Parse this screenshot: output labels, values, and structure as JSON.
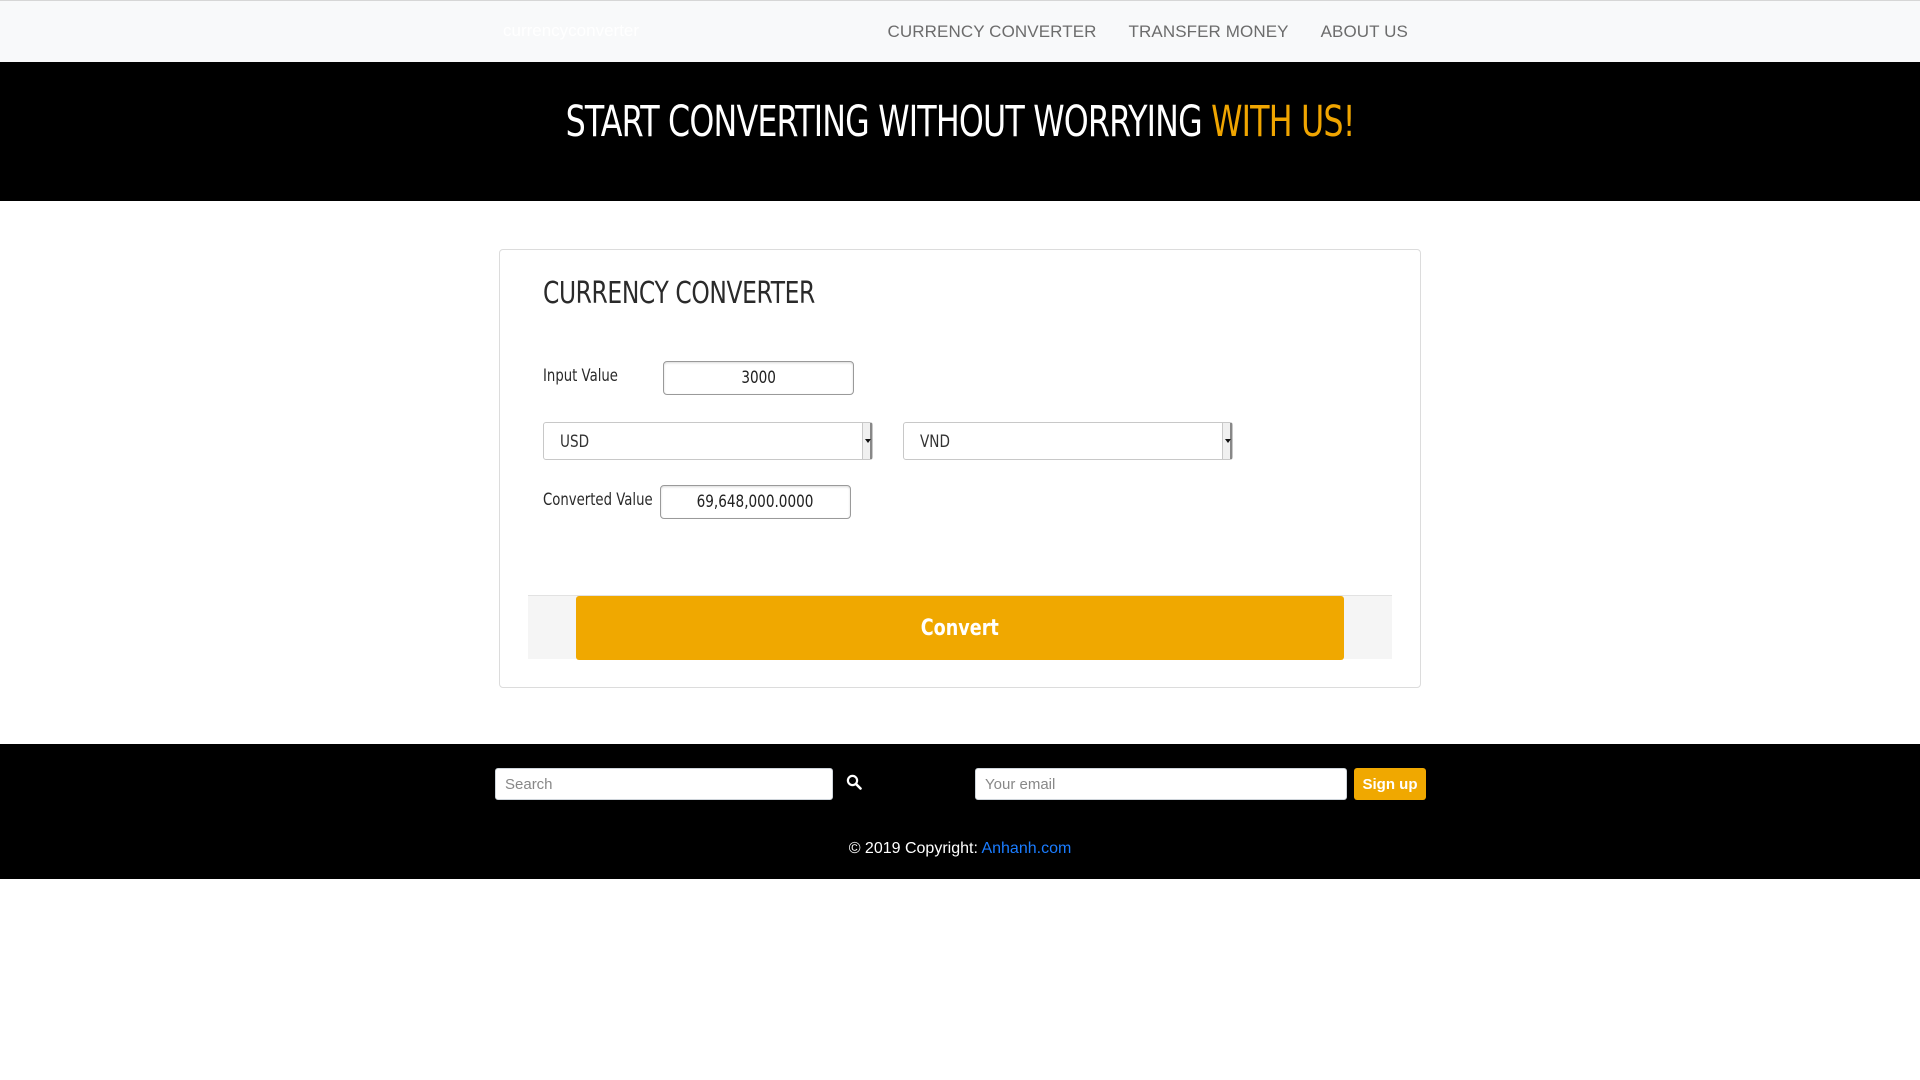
{
  "navbar": {
    "brand": "currencyconverter",
    "links": [
      "CURRENCY CONVERTER",
      "TRANSFER MONEY",
      "ABOUT US"
    ]
  },
  "hero": {
    "title_main": "START CONVERTING WITHOUT WORRYING ",
    "title_accent": "WITH US!"
  },
  "converter": {
    "title": "CURRENCY CONVERTER",
    "input_label": "Input Value",
    "input_value": "3000",
    "from_currency": "USD",
    "to_currency": "VND",
    "converted_label": "Converted Value",
    "converted_value": "69,648,000.0000",
    "convert_label": "Convert"
  },
  "footer": {
    "search_placeholder": "Search",
    "search_icon": "search-icon",
    "email_placeholder": "Your email",
    "signup_label": "Sign up",
    "copyright_prefix": "© 2019 Copyright: ",
    "copyright_link": "Anhanh.com"
  },
  "colors": {
    "accent": "#f0a800",
    "hero_bg": "#000000",
    "link": "#1a7cff"
  }
}
